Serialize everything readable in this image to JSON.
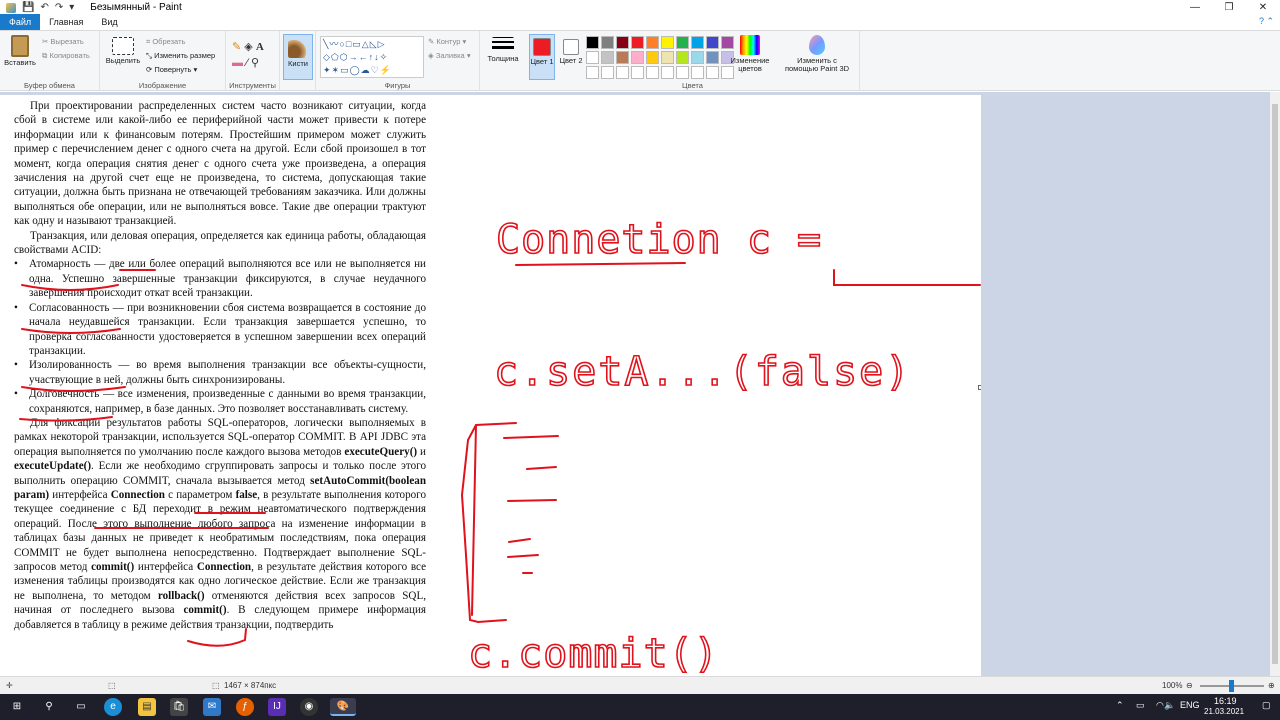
{
  "window": {
    "title": "Безымянный - Paint"
  },
  "menu": {
    "file": "Файл",
    "home": "Главная",
    "view": "Вид"
  },
  "ribbon": {
    "clipboard": {
      "paste": "Вставить",
      "cut": "Вырезать",
      "copy": "Копировать",
      "label": "Буфер обмена"
    },
    "image": {
      "select": "Выделить",
      "crop": "Обрезать",
      "resize": "Изменить размер",
      "rotate": "Повернуть",
      "label": "Изображение"
    },
    "tools": {
      "label": "Инструменты"
    },
    "brushes": {
      "label": "Кисти"
    },
    "shapes": {
      "outline": "Контур",
      "fill": "Заливка",
      "label": "Фигуры"
    },
    "size": {
      "label": "Толщина"
    },
    "colors": {
      "color1": "Цвет 1",
      "color2": "Цвет 2",
      "edit": "Изменение цветов",
      "paint3d": "Изменить с помощью Paint 3D",
      "label": "Цвета",
      "color1_value": "#ed1c24",
      "color2_value": "#ffffff",
      "palette": [
        "#000000",
        "#7f7f7f",
        "#880015",
        "#ed1c24",
        "#ff7f27",
        "#fff200",
        "#22b14c",
        "#00a2e8",
        "#3f48cc",
        "#a349a4",
        "#ffffff",
        "#c3c3c3",
        "#b97a57",
        "#ffaec9",
        "#ffc90e",
        "#efe4b0",
        "#b5e61d",
        "#99d9ea",
        "#7092be",
        "#c8bfe7",
        "#ffffff",
        "#ffffff",
        "#ffffff",
        "#ffffff",
        "#ffffff",
        "#ffffff",
        "#ffffff",
        "#ffffff",
        "#ffffff",
        "#ffffff"
      ]
    }
  },
  "document": {
    "p1": "При проектировании распределенных систем часто возникают ситуации, когда сбой в системе или какой-либо ее периферийной части может привести к потере информации или к финансовым потерям. Простейшим примером может служить пример с перечислением денег с одного счета на другой. Если сбой произошел в тот момент, когда операция снятия денег с одного счета уже произведена, а операция зачисления на другой счет еще не произведена, то система, допускающая такие ситуации, должна быть признана не отвечающей требованиям заказчика. Или должны выполняться обе операции, или не выполняться вовсе. Такие две операции трактуют как одну и называют транзакцией.",
    "p2": "Транзакция, или деловая операция, определяется как единица работы, обладающая свойствами ACID:",
    "b1_term": "Атомарность",
    "b1": " — две или более операций выполняются все или не выполняется ни одна. Успешно завершенные транзакции фиксируются, в случае неудачного завершения происходит откат всей транзакции.",
    "b2_term": "Согласованность",
    "b2": " — при возникновении сбоя система возвращается в состояние до начала неудавшейся транзакции. Если транзакция завершается успешно, то проверка согласованности удостоверяется в успешном завершении всех операций транзакции.",
    "b3_term": "Изолированность",
    "b3": " — во время выполнения транзакции все объекты-сущности, участвующие в ней, должны быть синхронизированы.",
    "b4_term": "Долговечность",
    "b4": " — все изменения, произведенные с данными во время транзакции, сохраняются, например, в базе данных. Это позволяет восстанавливать систему.",
    "p3a": "Для фиксации результатов работы SQL-операторов, логически выполняемых в рамках некоторой транзакции, используется SQL-оператор COMMIT. В API JDBC эта операция выполняется по умолчанию после каждого вызова методов ",
    "m1": "executeQuery()",
    "and": " и ",
    "m2": "executeUpdate()",
    "p3b": ". Если же необходимо сгруппировать запросы и только после этого выполнить операцию COMMIT, сначала вызывается метод ",
    "m3": "setAutoCommit(boolean param)",
    "p3c": " интерфейса ",
    "m4": "Connection",
    "p3d": " с параметром ",
    "m5": "false",
    "p3e": ", в результате выполнения которого текущее соединение с БД переходит в режим неавтоматического подтверждения операций. После этого выполнение любого запроса на изменение информации в таблицах базы данных не приведет к необратимым последствиям, пока операция COMMIT не будет выполнена непосредственно. Подтверждает выполнение SQL-запросов метод ",
    "m6": "commit()",
    "p3f": " интерфейса ",
    "m7": "Connection",
    "p3g": ", в результате действия которого все изменения таблицы производятся как одно логическое действие. Если же транзакция не выполнена, то методом ",
    "m8": "rollback()",
    "p3h": " отменяются действия всех запросов SQL, начиная от последнего вызова ",
    "m9": "commit()",
    "p3i": ". В следующем примере информация добавляется в таблицу в режиме действия транзакции, подтвердить"
  },
  "handwriting": {
    "line1": "Connetion c =",
    "line2": "c.setA...(false)",
    "line3": "c.commit()"
  },
  "status": {
    "size": "1467 × 874пкс",
    "zoom": "100%"
  },
  "tray": {
    "lang": "ENG",
    "time": "16:19",
    "date": "21.03.2021"
  }
}
